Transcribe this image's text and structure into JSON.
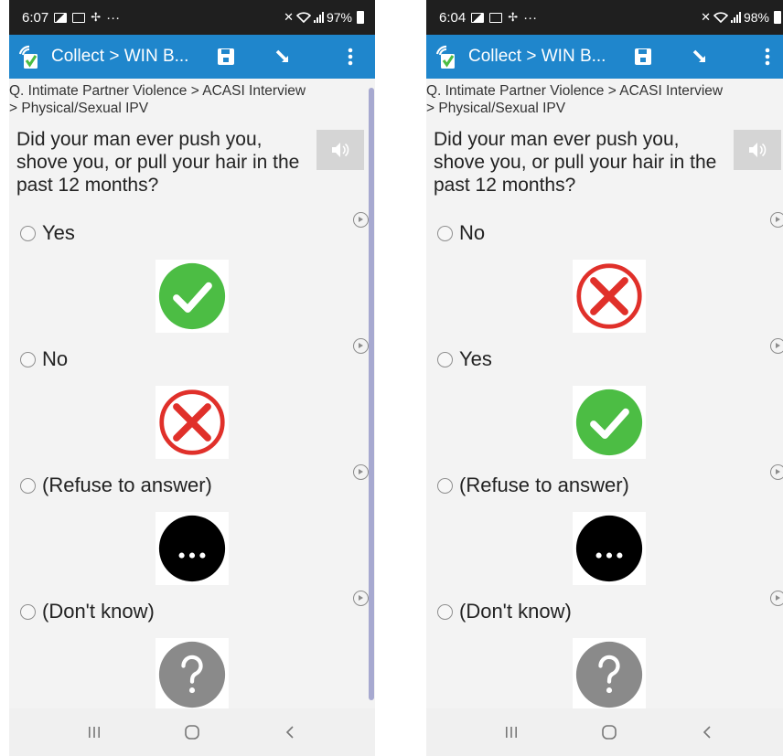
{
  "screens": [
    {
      "status": {
        "time": "6:07",
        "overflow": "···",
        "battery": "97%"
      },
      "appbar": {
        "title": "Collect > WIN B..."
      },
      "breadcrumb": "Q. Intimate Partner Violence > ACASI Interview\n> Physical/Sexual IPV",
      "question": "Did your man ever push you, shove you, or pull your hair in the past 12 months?",
      "options": [
        {
          "label": "Yes",
          "icon": "check-icon"
        },
        {
          "label": "No",
          "icon": "cross-icon"
        },
        {
          "label": "(Refuse to answer)",
          "icon": "ellipsis-icon"
        },
        {
          "label": "(Don't know)",
          "icon": "question-icon"
        }
      ]
    },
    {
      "status": {
        "time": "6:04",
        "overflow": "···",
        "battery": "98%"
      },
      "appbar": {
        "title": "Collect > WIN B..."
      },
      "breadcrumb": "Q. Intimate Partner Violence > ACASI Interview\n> Physical/Sexual IPV",
      "question": "Did your man ever push you, shove you, or pull your hair in the past 12 months?",
      "options": [
        {
          "label": "No",
          "icon": "cross-icon"
        },
        {
          "label": "Yes",
          "icon": "check-icon"
        },
        {
          "label": "(Refuse to answer)",
          "icon": "ellipsis-icon"
        },
        {
          "label": "(Don't know)",
          "icon": "question-icon"
        }
      ]
    }
  ],
  "colors": {
    "appbar": "#1f86cc",
    "statusbar": "#1f1f1f",
    "check": "#4cbd44",
    "cross": "#e0302a",
    "refuse": "#000000",
    "dontknow": "#8a8a8a"
  }
}
